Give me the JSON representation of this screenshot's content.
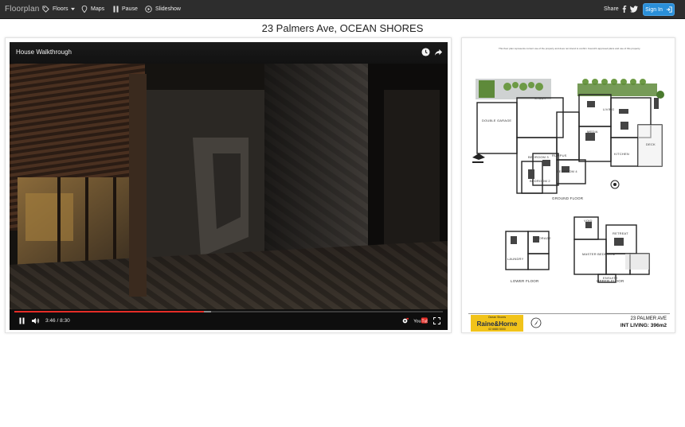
{
  "app": {
    "brand": "Floorplan",
    "nav": [
      {
        "label": "Floors",
        "icon": "tag-icon"
      },
      {
        "label": "Maps",
        "icon": "map-pin-icon"
      },
      {
        "label": "Pause",
        "icon": "pause-icon"
      },
      {
        "label": "Slideshow",
        "icon": "play-circle-icon"
      }
    ],
    "share_label": "Share",
    "signin_label": "Sign In"
  },
  "page": {
    "title": "23 Palmers Ave, OCEAN SHORES"
  },
  "video": {
    "title": "House Walkthrough",
    "time": "3:46 / 8:30",
    "played_fraction": 0.443,
    "buffered_fraction": 0.46
  },
  "floorplan": {
    "note": "This floor plan represents current use of the property and does not intend to confirm Council's approved plans and use of this property.",
    "labels": {
      "ground_floor": "GROUND FLOOR",
      "lower_floor": "LOWER FLOOR",
      "upper_floor": "UPPER FLOOR"
    },
    "rooms": {
      "study": "STUDY",
      "living": "LIVING",
      "double_garage": "DOUBLE GARAGE",
      "media": "MEDIA",
      "kitchen": "KITCHEN",
      "deck": "DECK",
      "bedroom2": "BEDROOM 2",
      "bedroom3": "BEDROOM 3",
      "bedroom4": "BEDROOM 4",
      "rumpus": "RUMPUS",
      "laundry": "LAUNDRY",
      "storage": "STORAGE",
      "master": "MASTER BEDROOM",
      "retreat": "RETREAT",
      "ensuite": "ENSUITE",
      "void": "VOID"
    },
    "agency": {
      "office": "Ocean Shores",
      "name": "Raine&Horne",
      "phone": "02 6680 5000"
    },
    "address": "23 PALMER AVE",
    "int_living": "INT LIVING: 396m2"
  },
  "colors": {
    "topbar": "#2d2d2d",
    "signin": "#2a8fd8",
    "progress": "#e52d27",
    "logo_bg": "#f1c31a"
  }
}
